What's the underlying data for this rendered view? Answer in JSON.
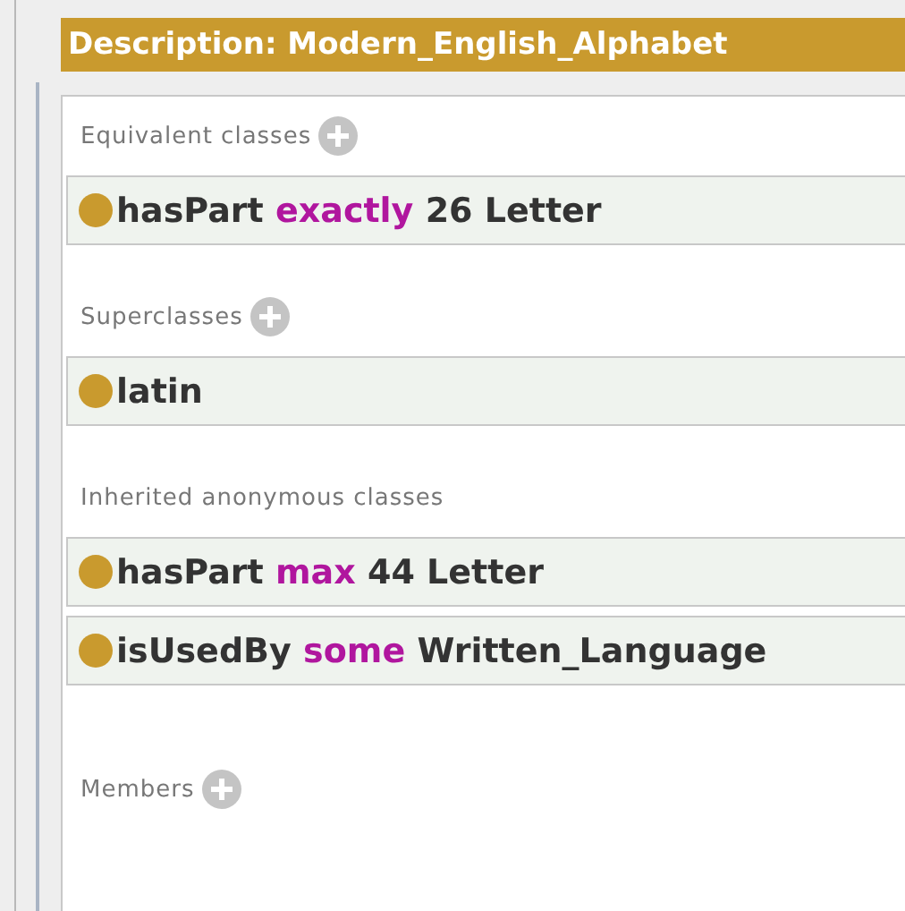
{
  "header": {
    "title": "Description: Modern_English_Alphabet"
  },
  "sections": [
    {
      "label": "Equivalent classes",
      "addable": true,
      "items": [
        {
          "parts": [
            {
              "text": "hasPart",
              "kind": "name"
            },
            {
              "text": "exactly",
              "kind": "keyword"
            },
            {
              "text": "26 Letter",
              "kind": "name"
            }
          ]
        }
      ]
    },
    {
      "label": "Superclasses",
      "addable": true,
      "items": [
        {
          "parts": [
            {
              "text": "latin",
              "kind": "name"
            }
          ]
        }
      ]
    },
    {
      "label": "Inherited anonymous classes",
      "addable": false,
      "items": [
        {
          "parts": [
            {
              "text": "hasPart",
              "kind": "name"
            },
            {
              "text": "max",
              "kind": "keyword"
            },
            {
              "text": "44 Letter",
              "kind": "name"
            }
          ]
        },
        {
          "parts": [
            {
              "text": "isUsedBy",
              "kind": "name"
            },
            {
              "text": "some",
              "kind": "keyword"
            },
            {
              "text": "Written_Language",
              "kind": "name"
            }
          ]
        }
      ]
    },
    {
      "label": "Members",
      "addable": true
    }
  ]
}
